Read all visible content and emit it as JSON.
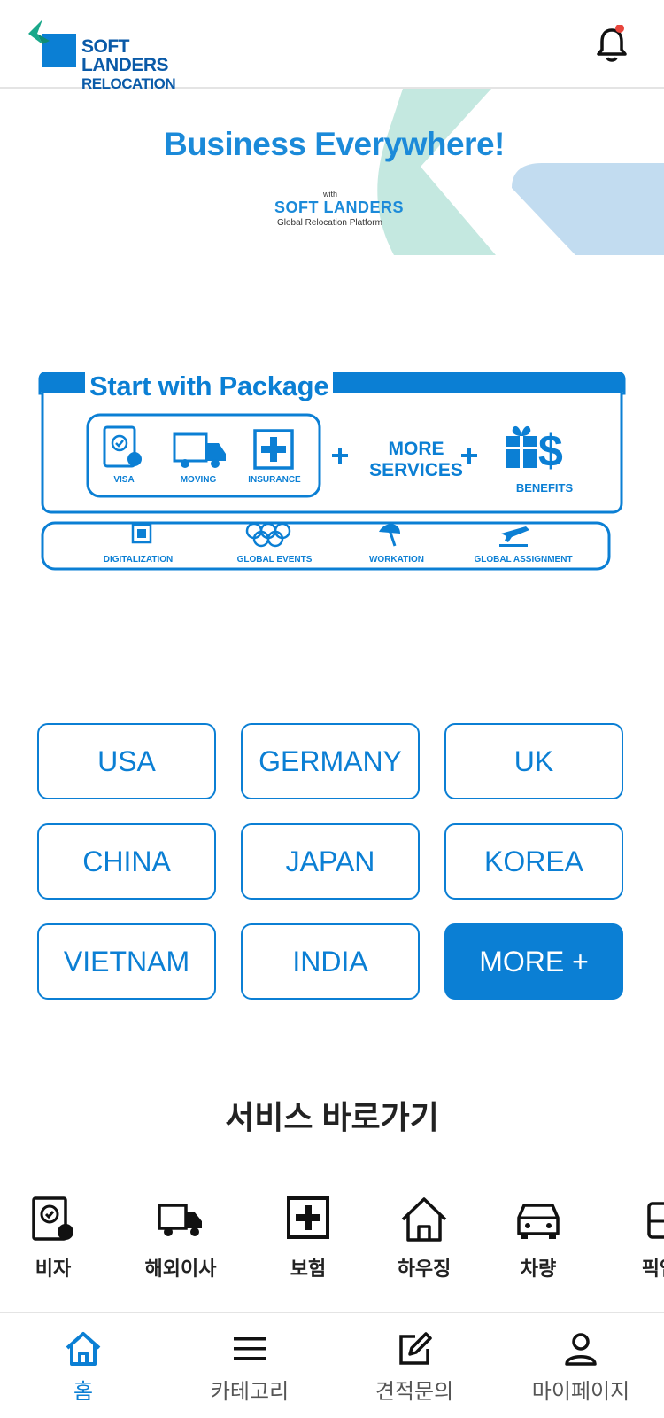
{
  "header": {
    "logo_line1": "SOFT LANDERS",
    "logo_line2": "RELOCATION",
    "notification_dot_color": "#e8453c"
  },
  "banner": {
    "title": "Business Everywhere!",
    "with": "with",
    "brand": "SOFT LANDERS",
    "subtitle": "Global Relocation Platform"
  },
  "package": {
    "title": "Start with Package",
    "items": [
      "VISA",
      "MOVING",
      "INSURANCE"
    ],
    "more_line1": "MORE",
    "more_line2": "SERVICES",
    "benefits": "BENEFITS",
    "extras": [
      "DIGITALIZATION",
      "GLOBAL EVENTS",
      "WORKATION",
      "GLOBAL ASSIGNMENT"
    ]
  },
  "countries": [
    "USA",
    "GERMANY",
    "UK",
    "CHINA",
    "JAPAN",
    "KOREA",
    "VIETNAM",
    "INDIA",
    "MORE +"
  ],
  "services_title": "서비스 바로가기",
  "services": [
    {
      "label": "비자",
      "icon": "visa-icon"
    },
    {
      "label": "해외이사",
      "icon": "truck-icon"
    },
    {
      "label": "보험",
      "icon": "insurance-icon"
    },
    {
      "label": "하우징",
      "icon": "house-icon"
    },
    {
      "label": "차량",
      "icon": "car-icon"
    },
    {
      "label": "픽업",
      "icon": "pickup-icon"
    }
  ],
  "tabs": [
    {
      "label": "홈",
      "icon": "home-icon"
    },
    {
      "label": "카테고리",
      "icon": "menu-icon"
    },
    {
      "label": "견적문의",
      "icon": "edit-icon"
    },
    {
      "label": "마이페이지",
      "icon": "user-icon"
    }
  ],
  "colors": {
    "accent": "#0b7fd4",
    "banner_blue": "#1b8ad9",
    "teal": "#c4e8e0",
    "light_blue": "#c2dcf0"
  }
}
